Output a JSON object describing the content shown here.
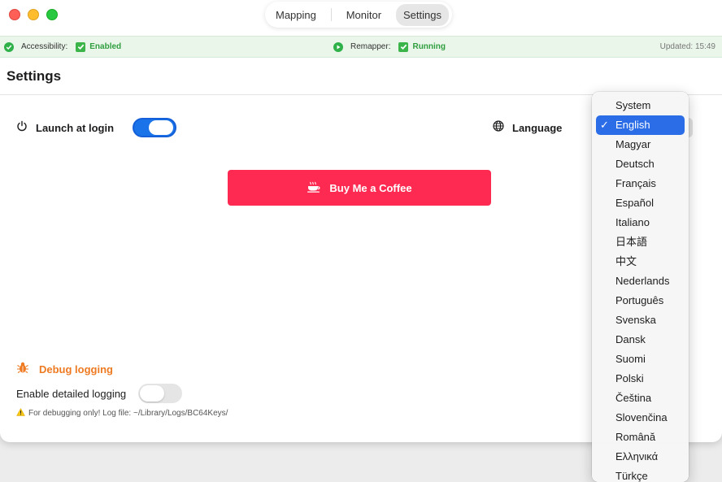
{
  "tabs": [
    {
      "label": "Mapping",
      "active": false
    },
    {
      "label": "Monitor",
      "active": false
    },
    {
      "label": "Settings",
      "active": true
    }
  ],
  "status": {
    "accessibility_label": "Accessibility:",
    "accessibility_value": "Enabled",
    "remapper_label": "Remapper:",
    "remapper_value": "Running",
    "updated": "Updated: 15:49"
  },
  "page": {
    "title": "Settings"
  },
  "general": {
    "launch_label": "Launch at login",
    "launch_on": true,
    "language_label": "Language"
  },
  "coffee": {
    "label": "Buy Me a Coffee"
  },
  "debug": {
    "title": "Debug logging",
    "detail_label": "Enable detailed logging",
    "detail_on": false,
    "note": "For debugging only! Log file: ~/Library/Logs/BC64Keys/"
  },
  "language_menu": {
    "selected": "English",
    "options": [
      "System",
      "English",
      "Magyar",
      "Deutsch",
      "Français",
      "Español",
      "Italiano",
      "日本語",
      "中文",
      "Nederlands",
      "Português",
      "Svenska",
      "Dansk",
      "Suomi",
      "Polski",
      "Čeština",
      "Slovenčina",
      "Română",
      "Ελληνικά",
      "Türkçe"
    ]
  },
  "colors": {
    "accent": "#1a73e8",
    "coffee_button": "#ff2a52",
    "debug_orange": "#ee7a22",
    "status_green": "#2f9e3f",
    "menu_selection": "#2b6de6"
  }
}
